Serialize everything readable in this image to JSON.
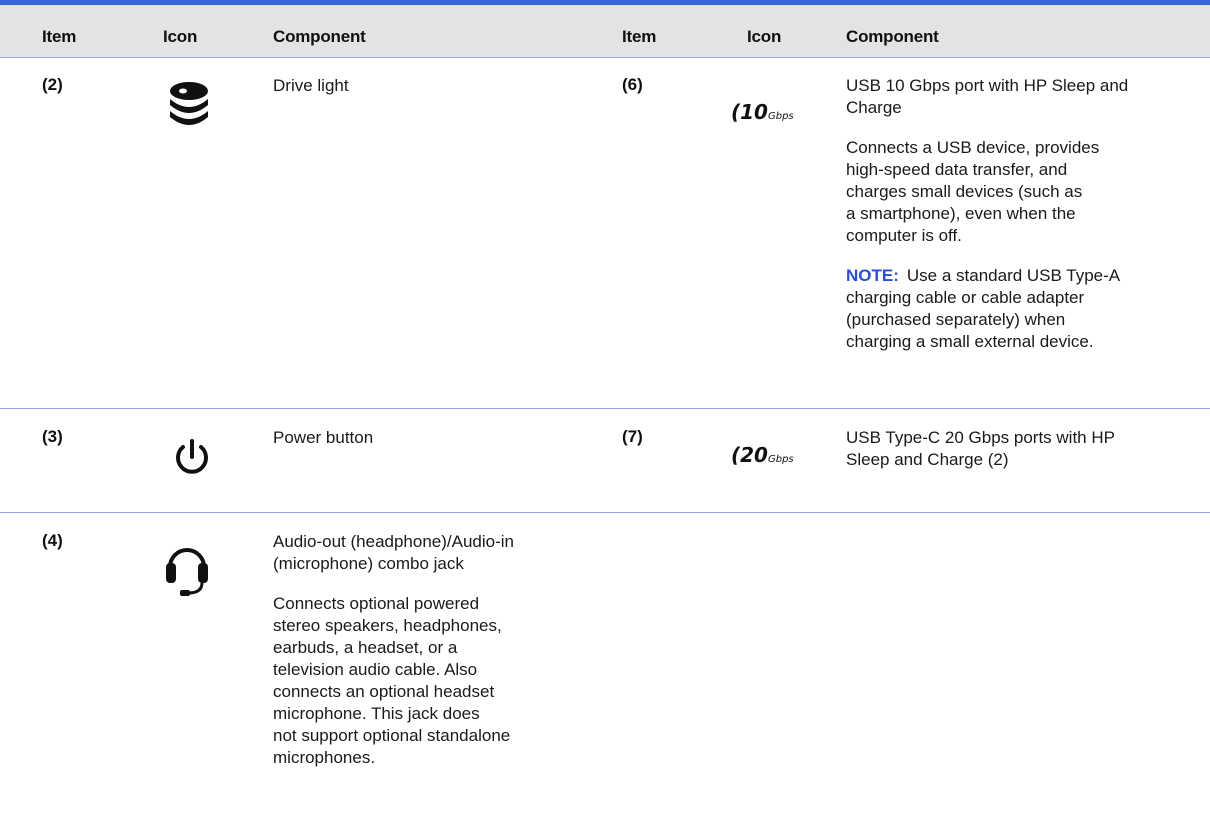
{
  "headers": {
    "item": "Item",
    "icon": "Icon",
    "component": "Component",
    "item2": "Item",
    "icon2": "Icon",
    "component2": "Component"
  },
  "left_rows": [
    {
      "item": "(2)",
      "icon": "drive-light-icon",
      "title": "Drive light"
    },
    {
      "item": "(3)",
      "icon": "power-icon",
      "title": "Power button"
    },
    {
      "item": "(4)",
      "icon": "headset-icon",
      "title": "Audio-out (headphone)/Audio-in\n(microphone) combo jack",
      "description": "Connects optional powered\nstereo speakers, headphones,\nearbuds, a headset, or a\ntelevision audio cable. Also\nconnects an optional headset\nmicrophone. This jack does\nnot support optional standalone\nmicrophones."
    }
  ],
  "right_rows": [
    {
      "item": "(6)",
      "icon": "usb-10gbps-icon",
      "icon_speed": "10",
      "icon_unit": "Gbps",
      "title": "USB 10 Gbps port with HP Sleep and\nCharge",
      "description": "Connects a USB device, provides\nhigh-speed data transfer, and\ncharges small devices (such as\na smartphone), even when the\ncomputer is off.",
      "note_label": "NOTE:",
      "note_text": "Use a standard USB Type-A\ncharging cable or cable adapter\n(purchased separately) when\ncharging a small external device."
    },
    {
      "item": "(7)",
      "icon": "usb-20gbps-icon",
      "icon_speed": "20",
      "icon_unit": "Gbps",
      "title": "USB Type-C 20 Gbps ports with HP\nSleep and Charge (2)"
    }
  ],
  "colors": {
    "accent": "#3a67d6",
    "header_bg": "#e3e3e3",
    "note": "#2a4fd0",
    "rule": "#8ea4e6"
  }
}
